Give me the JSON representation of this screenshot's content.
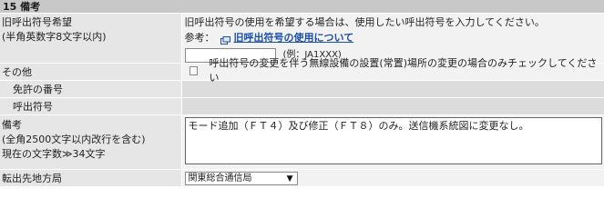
{
  "section": {
    "title": "15 備考"
  },
  "rows": {
    "kyuyobi": {
      "label_line1": "旧呼出符号希望",
      "label_line2": "(半角英数字8文字以内)",
      "instruction": "旧呼出符号の使用を希望する場合は、使用したい呼出符号を入力してください。",
      "ref_prefix": "参考：",
      "ref_link": "旧呼出符号の使用について",
      "input_value": "",
      "input_placeholder": "",
      "example": "(例：JA1XXX)"
    },
    "sonota": {
      "label": "その他",
      "checkbox_text": "呼出符号の変更を伴う無線設備の設置(常置)場所の変更の場合のみチェックしてください",
      "checked": false
    },
    "menkyo": {
      "label": "免許の番号"
    },
    "yobidashi": {
      "label": "呼出符号"
    },
    "biko": {
      "label_line1": "備考",
      "label_line2": "(全角2500文字以内改行を含む)",
      "label_line3": "現在の文字数≫34文字",
      "textarea_value": "モード追加（ＦＴ４）及び修正（ＦＴ８）のみ。送信機系統図に変更なし。"
    },
    "tenshutsu": {
      "label": "転出先地方局",
      "select_value": "関東総合通信局"
    }
  },
  "icons": {
    "link": "external-link-icon",
    "dropdown": "chevron-down-icon"
  },
  "colors": {
    "header_bg": "#c8c8c8",
    "label_bg": "#e6e6e6",
    "value_bg": "#f2f2f2",
    "link": "#1a4ea8"
  }
}
